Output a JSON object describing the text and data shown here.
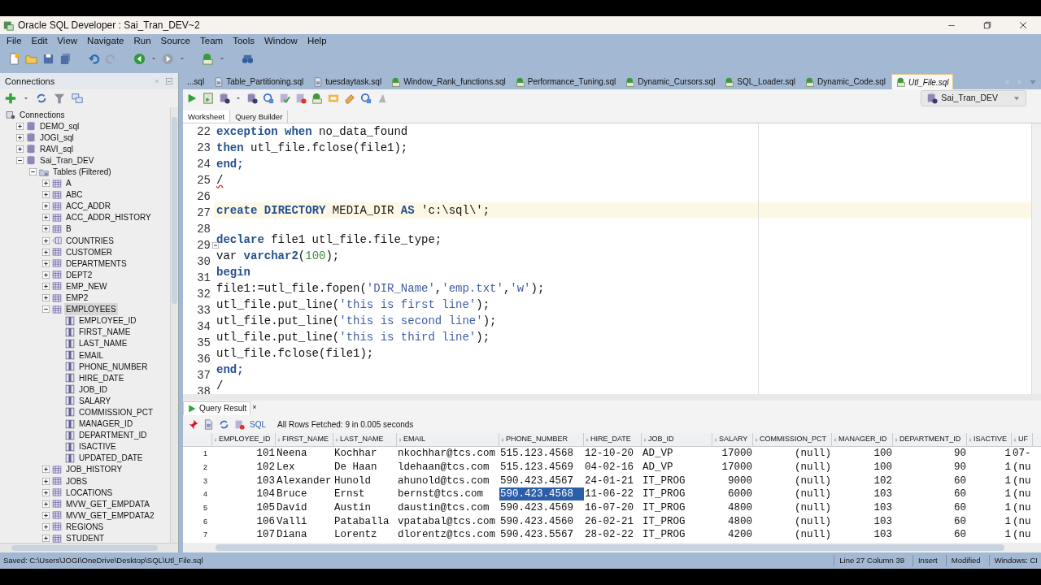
{
  "window": {
    "title": "Oracle SQL Developer : Sai_Tran_DEV~2"
  },
  "menu": [
    "File",
    "Edit",
    "View",
    "Navigate",
    "Run",
    "Source",
    "Team",
    "Tools",
    "Window",
    "Help"
  ],
  "connections_panel": {
    "title": "Connections",
    "tree": [
      {
        "label": "Connections",
        "kind": "root",
        "selected": false,
        "children": [
          {
            "label": "DEMO_sql",
            "kind": "connection",
            "expanded": false,
            "selected": false
          },
          {
            "label": "JOGI_sql",
            "kind": "connection",
            "expanded": false,
            "selected": false
          },
          {
            "label": "RAVI_sql",
            "kind": "connection",
            "expanded": false,
            "selected": false
          },
          {
            "label": "Sai_Tran_DEV",
            "kind": "connection",
            "expanded": true,
            "selected": false,
            "children": [
              {
                "label": "Tables (Filtered)",
                "kind": "folder",
                "expanded": true,
                "selected": false,
                "children": [
                  {
                    "label": "A",
                    "kind": "table",
                    "expanded": false,
                    "selected": false
                  },
                  {
                    "label": "ABC",
                    "kind": "table",
                    "expanded": false,
                    "selected": false
                  },
                  {
                    "label": "ACC_ADDR",
                    "kind": "table",
                    "expanded": false,
                    "selected": false
                  },
                  {
                    "label": "ACC_ADDR_HISTORY",
                    "kind": "table",
                    "expanded": false,
                    "selected": false
                  },
                  {
                    "label": "B",
                    "kind": "table",
                    "expanded": false,
                    "selected": false
                  },
                  {
                    "label": "COUNTRIES",
                    "kind": "index-table",
                    "expanded": false,
                    "selected": false
                  },
                  {
                    "label": "CUSTOMER",
                    "kind": "table",
                    "expanded": false,
                    "selected": false
                  },
                  {
                    "label": "DEPARTMENTS",
                    "kind": "table",
                    "expanded": false,
                    "selected": false
                  },
                  {
                    "label": "DEPT2",
                    "kind": "table",
                    "expanded": false,
                    "selected": false
                  },
                  {
                    "label": "EMP_NEW",
                    "kind": "table",
                    "expanded": false,
                    "selected": false
                  },
                  {
                    "label": "EMP2",
                    "kind": "table",
                    "expanded": false,
                    "selected": false
                  },
                  {
                    "label": "EMPLOYEES",
                    "kind": "table",
                    "expanded": true,
                    "selected": true,
                    "children": [
                      {
                        "label": "EMPLOYEE_ID",
                        "kind": "column",
                        "selected": false
                      },
                      {
                        "label": "FIRST_NAME",
                        "kind": "column",
                        "selected": false
                      },
                      {
                        "label": "LAST_NAME",
                        "kind": "column",
                        "selected": false
                      },
                      {
                        "label": "EMAIL",
                        "kind": "column",
                        "selected": false
                      },
                      {
                        "label": "PHONE_NUMBER",
                        "kind": "column",
                        "selected": false
                      },
                      {
                        "label": "HIRE_DATE",
                        "kind": "column",
                        "selected": false
                      },
                      {
                        "label": "JOB_ID",
                        "kind": "column",
                        "selected": false
                      },
                      {
                        "label": "SALARY",
                        "kind": "column",
                        "selected": false
                      },
                      {
                        "label": "COMMISSION_PCT",
                        "kind": "column",
                        "selected": false
                      },
                      {
                        "label": "MANAGER_ID",
                        "kind": "column",
                        "selected": false
                      },
                      {
                        "label": "DEPARTMENT_ID",
                        "kind": "column",
                        "selected": false
                      },
                      {
                        "label": "ISACTIVE",
                        "kind": "column",
                        "selected": false
                      },
                      {
                        "label": "UPDATED_DATE",
                        "kind": "column",
                        "selected": false
                      }
                    ]
                  },
                  {
                    "label": "JOB_HISTORY",
                    "kind": "table",
                    "expanded": false,
                    "selected": false
                  },
                  {
                    "label": "JOBS",
                    "kind": "table",
                    "expanded": false,
                    "selected": false
                  },
                  {
                    "label": "LOCATIONS",
                    "kind": "table",
                    "expanded": false,
                    "selected": false
                  },
                  {
                    "label": "MVW_GET_EMPDATA",
                    "kind": "table",
                    "expanded": false,
                    "selected": false
                  },
                  {
                    "label": "MVW_GET_EMPDATA2",
                    "kind": "table",
                    "expanded": false,
                    "selected": false
                  },
                  {
                    "label": "REGIONS",
                    "kind": "table",
                    "expanded": false,
                    "selected": false
                  },
                  {
                    "label": "STUDENT",
                    "kind": "table",
                    "expanded": false,
                    "selected": false
                  }
                ]
              }
            ]
          }
        ]
      }
    ]
  },
  "editor_tabs": [
    {
      "label": "...sql",
      "kind": "overflow",
      "selected": false
    },
    {
      "label": "Table_Partitioning.sql",
      "kind": "file",
      "selected": false
    },
    {
      "label": "tuesdaytask.sql",
      "kind": "file",
      "selected": false
    },
    {
      "label": "Window_Rank_functions.sql",
      "kind": "worksheet",
      "selected": false
    },
    {
      "label": "Performance_Tuning.sql",
      "kind": "worksheet",
      "selected": false
    },
    {
      "label": "Dynamic_Cursors.sql",
      "kind": "worksheet",
      "selected": false
    },
    {
      "label": "SQL_Loader.sql",
      "kind": "worksheet",
      "selected": false
    },
    {
      "label": "Dynamic_Code.sql",
      "kind": "worksheet",
      "selected": false
    },
    {
      "label": "Utl_File.sql",
      "kind": "worksheet",
      "selected": true
    }
  ],
  "connection_picker": {
    "value": "Sai_Tran_DEV"
  },
  "worksheet_tabs": [
    {
      "label": "Worksheet",
      "selected": true
    },
    {
      "label": "Query Builder",
      "selected": false
    }
  ],
  "code_lines": [
    {
      "number": "22",
      "current": false,
      "fold": false,
      "tokens": [
        {
          "text": "exception",
          "kind": "keyword"
        },
        {
          "text": " when",
          "kind": "keyword"
        },
        {
          "text": " no_data_found",
          "kind": "plain"
        }
      ]
    },
    {
      "number": "23",
      "current": false,
      "fold": false,
      "tokens": [
        {
          "text": "then",
          "kind": "keyword"
        },
        {
          "text": " utl_file.fclose(file1);",
          "kind": "plain"
        }
      ]
    },
    {
      "number": "24",
      "current": false,
      "fold": false,
      "tokens": [
        {
          "text": "end;",
          "kind": "keyword"
        }
      ]
    },
    {
      "number": "25",
      "current": false,
      "fold": false,
      "tokens": [
        {
          "text": "/",
          "kind": "error"
        }
      ]
    },
    {
      "number": "26",
      "current": false,
      "fold": false
    },
    {
      "number": "27",
      "current": true,
      "fold": false,
      "tokens": [
        {
          "text": "create",
          "kind": "keyword"
        },
        {
          "text": " DIRECTORY",
          "kind": "keyword"
        },
        {
          "text": " MEDIA_DIR ",
          "kind": "plain"
        },
        {
          "text": "AS",
          "kind": "keyword"
        },
        {
          "text": " 'c:\\sql\\';",
          "kind": "plain"
        }
      ]
    },
    {
      "number": "28",
      "current": false,
      "fold": false
    },
    {
      "number": "29",
      "current": false,
      "fold": true,
      "tokens": [
        {
          "text": "declare",
          "kind": "keyword"
        },
        {
          "text": " file1 utl_file.file_type;",
          "kind": "plain"
        }
      ]
    },
    {
      "number": "30",
      "current": false,
      "fold": false,
      "tokens": [
        {
          "text": "var ",
          "kind": "plain"
        },
        {
          "text": "varchar2",
          "kind": "keyword"
        },
        {
          "text": "(",
          "kind": "plain"
        },
        {
          "text": "100",
          "kind": "number"
        },
        {
          "text": ");",
          "kind": "plain"
        }
      ]
    },
    {
      "number": "31",
      "current": false,
      "fold": false,
      "tokens": [
        {
          "text": "begin",
          "kind": "keyword"
        }
      ]
    },
    {
      "number": "32",
      "current": false,
      "fold": false,
      "tokens": [
        {
          "text": "file1:=utl_file.fopen(",
          "kind": "plain"
        },
        {
          "text": "'DIR_Name'",
          "kind": "string"
        },
        {
          "text": ",",
          "kind": "plain"
        },
        {
          "text": "'emp.txt'",
          "kind": "string"
        },
        {
          "text": ",",
          "kind": "plain"
        },
        {
          "text": "'w'",
          "kind": "string"
        },
        {
          "text": ");",
          "kind": "plain"
        }
      ]
    },
    {
      "number": "33",
      "current": false,
      "fold": false,
      "tokens": [
        {
          "text": "utl_file.put_line(",
          "kind": "plain"
        },
        {
          "text": "'this is first line'",
          "kind": "string"
        },
        {
          "text": ");",
          "kind": "plain"
        }
      ]
    },
    {
      "number": "34",
      "current": false,
      "fold": false,
      "tokens": [
        {
          "text": "utl_file.put_line(",
          "kind": "plain"
        },
        {
          "text": "'this is second line'",
          "kind": "string"
        },
        {
          "text": ");",
          "kind": "plain"
        }
      ]
    },
    {
      "number": "35",
      "current": false,
      "fold": false,
      "tokens": [
        {
          "text": "utl_file.put_line(",
          "kind": "plain"
        },
        {
          "text": "'this is third line'",
          "kind": "string"
        },
        {
          "text": ");",
          "kind": "plain"
        }
      ]
    },
    {
      "number": "36",
      "current": false,
      "fold": false,
      "tokens": [
        {
          "text": "utl_file.fclose(file1);",
          "kind": "plain"
        }
      ]
    },
    {
      "number": "37",
      "current": false,
      "fold": false,
      "tokens": [
        {
          "text": "end;",
          "kind": "keyword"
        }
      ]
    },
    {
      "number": "38",
      "current": false,
      "fold": false,
      "tokens": [
        {
          "text": "/",
          "kind": "plain"
        }
      ]
    }
  ],
  "result_panel": {
    "tab": "Query Result",
    "tab_close": "×",
    "sql_link": "SQL",
    "message": "All Rows Fetched: 9 in 0.005 seconds",
    "columns": [
      {
        "label": "EMPLOYEE_ID",
        "kind": "number"
      },
      {
        "label": "FIRST_NAME",
        "kind": "text"
      },
      {
        "label": "LAST_NAME",
        "kind": "text"
      },
      {
        "label": "EMAIL",
        "kind": "text"
      },
      {
        "label": "PHONE_NUMBER",
        "kind": "text"
      },
      {
        "label": "HIRE_DATE",
        "kind": "text"
      },
      {
        "label": "JOB_ID",
        "kind": "text"
      },
      {
        "label": "SALARY",
        "kind": "number"
      },
      {
        "label": "COMMISSION_PCT",
        "kind": "number"
      },
      {
        "label": "MANAGER_ID",
        "kind": "number"
      },
      {
        "label": "DEPARTMENT_ID",
        "kind": "number"
      },
      {
        "label": "ISACTIVE",
        "kind": "number"
      },
      {
        "label": "UF",
        "kind": "text"
      }
    ],
    "rows": [
      {
        "number": "1",
        "cells": [
          {
            "text": "101",
            "selected": false
          },
          {
            "text": "Neena",
            "selected": false
          },
          {
            "text": "Kochhar",
            "selected": false
          },
          {
            "text": "nkochhar@tcs.com",
            "selected": false
          },
          {
            "text": "515.123.4568",
            "selected": false
          },
          {
            "text": "12-10-20",
            "selected": false
          },
          {
            "text": "AD_VP",
            "selected": false
          },
          {
            "text": "17000",
            "selected": false
          },
          {
            "text": "(null)",
            "selected": false
          },
          {
            "text": "100",
            "selected": false
          },
          {
            "text": "90",
            "selected": false
          },
          {
            "text": "1",
            "selected": false
          },
          {
            "text": "07-",
            "selected": false
          }
        ]
      },
      {
        "number": "2",
        "cells": [
          {
            "text": "102",
            "selected": false
          },
          {
            "text": "Lex",
            "selected": false
          },
          {
            "text": "De Haan",
            "selected": false
          },
          {
            "text": "ldehaan@tcs.com",
            "selected": false
          },
          {
            "text": "515.123.4569",
            "selected": false
          },
          {
            "text": "04-02-16",
            "selected": false
          },
          {
            "text": "AD_VP",
            "selected": false
          },
          {
            "text": "17000",
            "selected": false
          },
          {
            "text": "(null)",
            "selected": false
          },
          {
            "text": "100",
            "selected": false
          },
          {
            "text": "90",
            "selected": false
          },
          {
            "text": "1",
            "selected": false
          },
          {
            "text": "(nu",
            "selected": false
          }
        ]
      },
      {
        "number": "3",
        "cells": [
          {
            "text": "103",
            "selected": false
          },
          {
            "text": "Alexander",
            "selected": false
          },
          {
            "text": "Hunold",
            "selected": false
          },
          {
            "text": "ahunold@tcs.com",
            "selected": false
          },
          {
            "text": "590.423.4567",
            "selected": false
          },
          {
            "text": "24-01-21",
            "selected": false
          },
          {
            "text": "IT_PROG",
            "selected": false
          },
          {
            "text": "9000",
            "selected": false
          },
          {
            "text": "(null)",
            "selected": false
          },
          {
            "text": "102",
            "selected": false
          },
          {
            "text": "60",
            "selected": false
          },
          {
            "text": "1",
            "selected": false
          },
          {
            "text": "(nu",
            "selected": false
          }
        ]
      },
      {
        "number": "4",
        "cells": [
          {
            "text": "104",
            "selected": false
          },
          {
            "text": "Bruce",
            "selected": false
          },
          {
            "text": "Ernst",
            "selected": false
          },
          {
            "text": "bernst@tcs.com",
            "selected": false
          },
          {
            "text": "590.423.4568",
            "selected": true
          },
          {
            "text": "11-06-22",
            "selected": false
          },
          {
            "text": "IT_PROG",
            "selected": false
          },
          {
            "text": "6000",
            "selected": false
          },
          {
            "text": "(null)",
            "selected": false
          },
          {
            "text": "103",
            "selected": false
          },
          {
            "text": "60",
            "selected": false
          },
          {
            "text": "1",
            "selected": false
          },
          {
            "text": "(nu",
            "selected": false
          }
        ]
      },
      {
        "number": "5",
        "cells": [
          {
            "text": "105",
            "selected": false
          },
          {
            "text": "David",
            "selected": false
          },
          {
            "text": "Austin",
            "selected": false
          },
          {
            "text": "daustin@tcs.com",
            "selected": false
          },
          {
            "text": "590.423.4569",
            "selected": false
          },
          {
            "text": "16-07-20",
            "selected": false
          },
          {
            "text": "IT_PROG",
            "selected": false
          },
          {
            "text": "4800",
            "selected": false
          },
          {
            "text": "(null)",
            "selected": false
          },
          {
            "text": "103",
            "selected": false
          },
          {
            "text": "60",
            "selected": false
          },
          {
            "text": "1",
            "selected": false
          },
          {
            "text": "(nu",
            "selected": false
          }
        ]
      },
      {
        "number": "6",
        "cells": [
          {
            "text": "106",
            "selected": false
          },
          {
            "text": "Valli",
            "selected": false
          },
          {
            "text": "Pataballa",
            "selected": false
          },
          {
            "text": "vpatabal@tcs.com",
            "selected": false
          },
          {
            "text": "590.423.4560",
            "selected": false
          },
          {
            "text": "26-02-21",
            "selected": false
          },
          {
            "text": "IT_PROG",
            "selected": false
          },
          {
            "text": "4800",
            "selected": false
          },
          {
            "text": "(null)",
            "selected": false
          },
          {
            "text": "103",
            "selected": false
          },
          {
            "text": "60",
            "selected": false
          },
          {
            "text": "1",
            "selected": false
          },
          {
            "text": "(nu",
            "selected": false
          }
        ]
      },
      {
        "number": "7",
        "cells": [
          {
            "text": "107",
            "selected": false
          },
          {
            "text": "Diana",
            "selected": false
          },
          {
            "text": "Lorentz",
            "selected": false
          },
          {
            "text": "dlorentz@tcs.com",
            "selected": false
          },
          {
            "text": "590.423.5567",
            "selected": false
          },
          {
            "text": "28-02-22",
            "selected": false
          },
          {
            "text": "IT_PROG",
            "selected": false
          },
          {
            "text": "4200",
            "selected": false
          },
          {
            "text": "(null)",
            "selected": false
          },
          {
            "text": "103",
            "selected": false
          },
          {
            "text": "60",
            "selected": false
          },
          {
            "text": "1",
            "selected": false
          },
          {
            "text": "(nu",
            "selected": false
          }
        ]
      }
    ]
  },
  "status_bar": {
    "message": "Saved: C:\\Users\\JOGI\\OneDrive\\Desktop\\SQL\\Utl_File.sql",
    "position": "Line 27 Column 39",
    "mode": "Insert",
    "state": "Modified",
    "platform": "Windows: CI"
  }
}
